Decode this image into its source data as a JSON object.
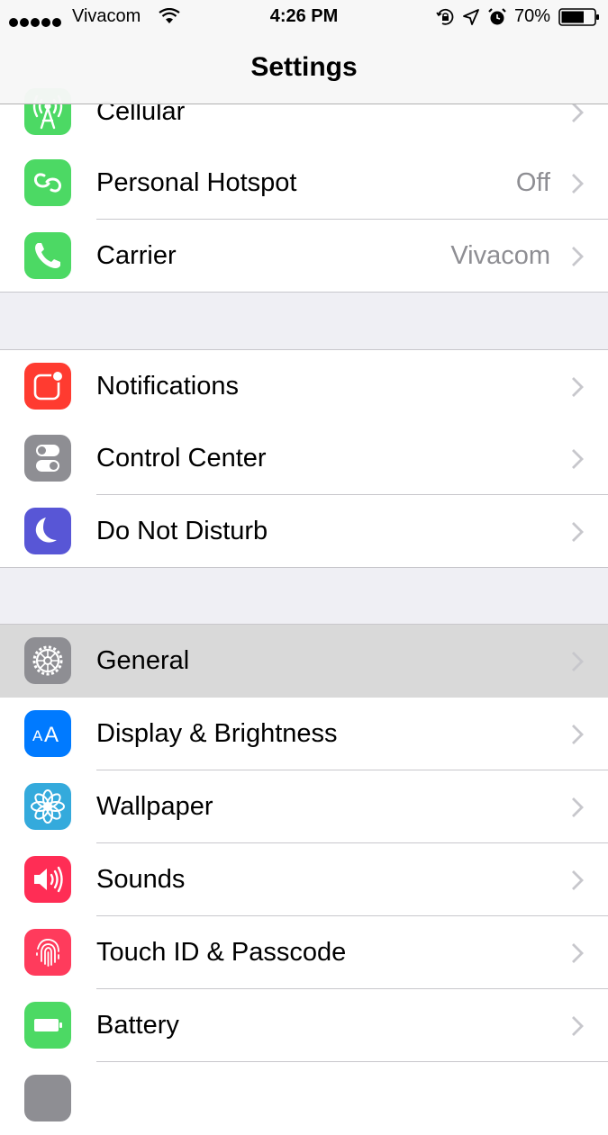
{
  "status_bar": {
    "carrier": "Vivacom",
    "time": "4:26 PM",
    "battery": "70%",
    "battery_level": 0.7
  },
  "nav": {
    "title": "Settings"
  },
  "groups": [
    {
      "items": [
        {
          "label": "Cellular",
          "value": "",
          "icon": "cellular-icon",
          "color": "#4cd964"
        },
        {
          "label": "Personal Hotspot",
          "value": "Off",
          "icon": "personal-hotspot-icon",
          "color": "#4cd964"
        },
        {
          "label": "Carrier",
          "value": "Vivacom",
          "icon": "phone-icon",
          "color": "#4cd964"
        }
      ]
    },
    {
      "items": [
        {
          "label": "Notifications",
          "value": "",
          "icon": "notifications-icon",
          "color": "#ff3b30"
        },
        {
          "label": "Control Center",
          "value": "",
          "icon": "control-center-icon",
          "color": "#8e8e93"
        },
        {
          "label": "Do Not Disturb",
          "value": "",
          "icon": "moon-icon",
          "color": "#5856d6"
        }
      ]
    },
    {
      "items": [
        {
          "label": "General",
          "value": "",
          "icon": "gear-icon",
          "color": "#8e8e93",
          "selected": true
        },
        {
          "label": "Display & Brightness",
          "value": "",
          "icon": "display-brightness-icon",
          "color": "#007aff"
        },
        {
          "label": "Wallpaper",
          "value": "",
          "icon": "wallpaper-flower-icon",
          "color": "#34aadc"
        },
        {
          "label": "Sounds",
          "value": "",
          "icon": "speaker-icon",
          "color": "#ff2d55"
        },
        {
          "label": "Touch ID & Passcode",
          "value": "",
          "icon": "fingerprint-icon",
          "color": "#ff3b5c"
        },
        {
          "label": "Battery",
          "value": "",
          "icon": "battery-icon",
          "color": "#4cd964"
        }
      ]
    }
  ]
}
